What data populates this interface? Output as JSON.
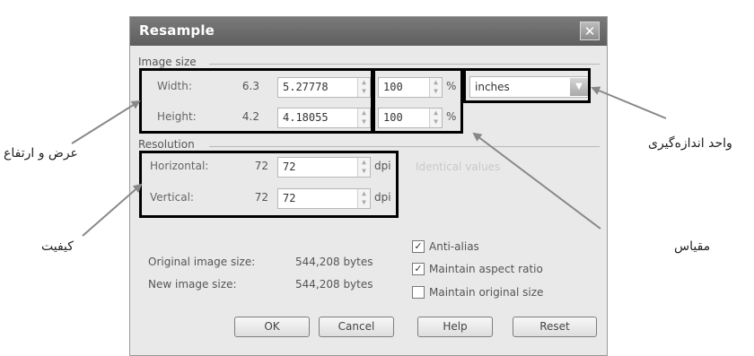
{
  "dialog": {
    "title": "Resample",
    "close_glyph": "✕",
    "image_size": {
      "section_label": "Image size",
      "width": {
        "label": "Width:",
        "original": "6.3",
        "value": "5.27778",
        "percent": "100",
        "percent_unit": "%"
      },
      "height": {
        "label": "Height:",
        "original": "4.2",
        "value": "4.18055",
        "percent": "100",
        "percent_unit": "%"
      },
      "units": "inches"
    },
    "resolution": {
      "section_label": "Resolution",
      "horizontal": {
        "label": "Horizontal:",
        "original": "72",
        "value": "72",
        "unit": "dpi"
      },
      "vertical": {
        "label": "Vertical:",
        "original": "72",
        "value": "72",
        "unit": "dpi"
      },
      "identical_values_label": "Identical values"
    },
    "info": {
      "original_label": "Original image size:",
      "original_value": "544,208 bytes",
      "new_label": "New image size:",
      "new_value": "544,208 bytes"
    },
    "options": {
      "anti_alias": {
        "label": "Anti-alias",
        "checked": true
      },
      "maintain_aspect": {
        "label": "Maintain aspect ratio",
        "checked": true
      },
      "maintain_original": {
        "label": "Maintain original size",
        "checked": false
      }
    },
    "buttons": {
      "ok": "OK",
      "cancel": "Cancel",
      "help": "Help",
      "reset": "Reset"
    }
  },
  "callouts": {
    "width_height": "عرض و ارتفاع",
    "quality": "کیفیت",
    "units": "واحد اندازه‌گیری",
    "scale": "مقیاس"
  },
  "check_glyph": "✓"
}
